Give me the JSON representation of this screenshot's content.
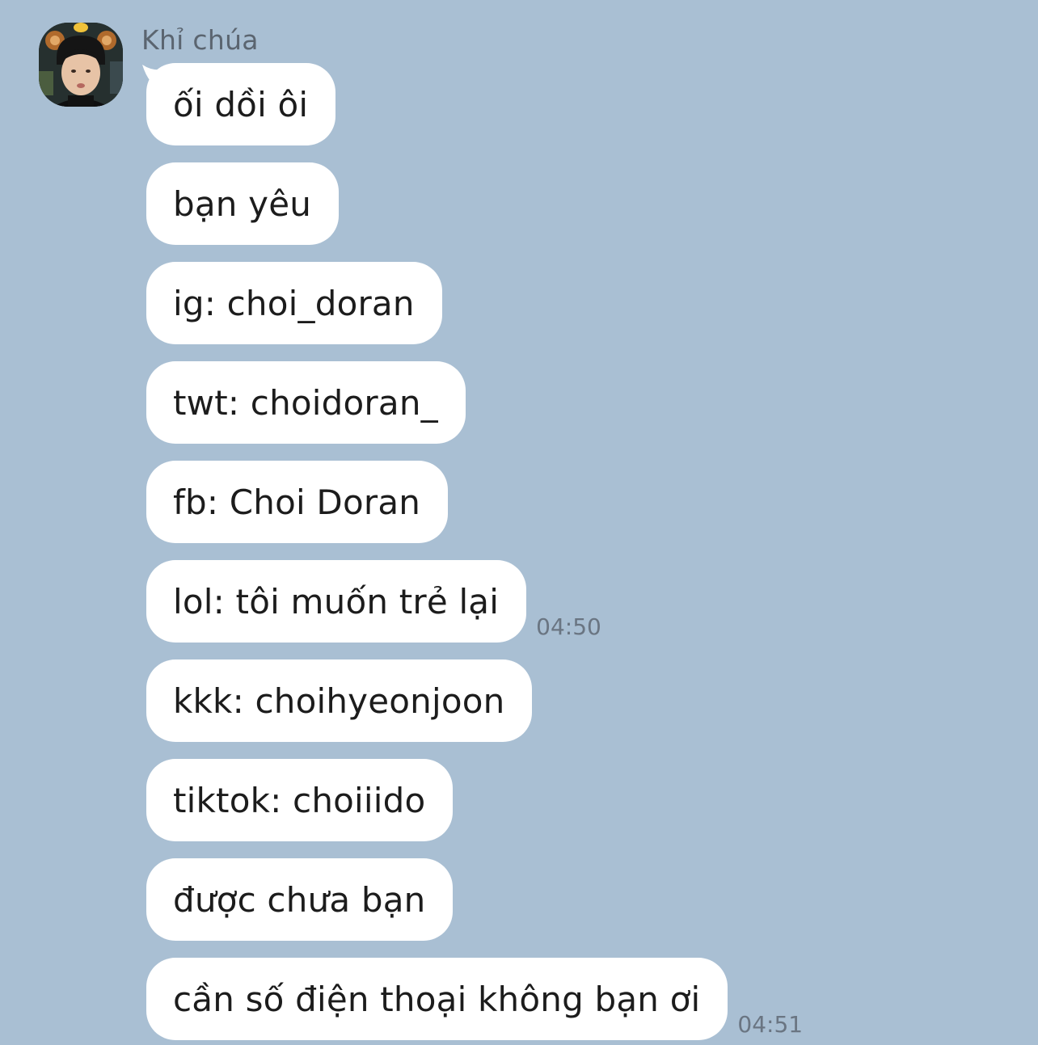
{
  "conversation": {
    "sender_name": "Khỉ chúa",
    "avatar_icon": "user-avatar-photo",
    "messages": [
      {
        "text": "ối dồi ôi",
        "time": ""
      },
      {
        "text": "bạn yêu",
        "time": ""
      },
      {
        "text": "ig: choi_doran",
        "time": ""
      },
      {
        "text": "twt: choidoran_",
        "time": ""
      },
      {
        "text": "fb: Choi Doran",
        "time": ""
      },
      {
        "text": "lol: tôi muốn trẻ lại",
        "time": "04:50"
      },
      {
        "text": "kkk: choihyeonjoon",
        "time": ""
      },
      {
        "text": "tiktok: choiiido",
        "time": ""
      },
      {
        "text": "được chưa bạn",
        "time": ""
      },
      {
        "text": "cần số điện thoại không bạn ơi",
        "time": "04:51"
      }
    ]
  },
  "colors": {
    "background": "#a9bfd3",
    "bubble": "#ffffff",
    "text": "#1c1c1c",
    "meta_text": "#6a7582"
  }
}
